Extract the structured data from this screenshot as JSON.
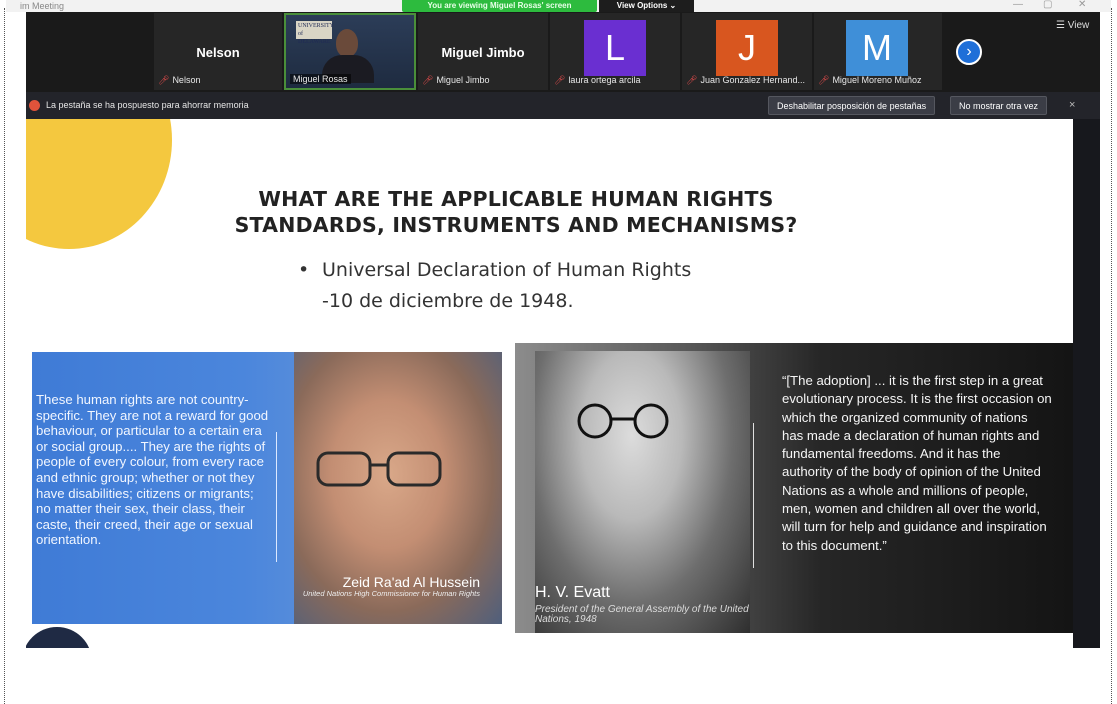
{
  "window": {
    "title": "im Meeting",
    "banner": "You are viewing Miguel Rosas' screen",
    "view_options": "View Options ⌄",
    "controls": [
      "—",
      "▢",
      "✕"
    ]
  },
  "participants": [
    {
      "display": "Nelson",
      "caption": "Nelson",
      "muted": true
    },
    {
      "display": "",
      "caption": "Miguel Rosas",
      "muted": false,
      "video": true
    },
    {
      "display": "Miguel Jimbo",
      "caption": "Miguel Jimbo",
      "muted": true
    },
    {
      "display": "L",
      "caption": "laura ortega arcila",
      "muted": true,
      "color": "#6a2fd1"
    },
    {
      "display": "J",
      "caption": "Juan Gonzalez Hernand...",
      "muted": true,
      "color": "#d8561f"
    },
    {
      "display": "M",
      "caption": "Miguel Moreno Muñoz",
      "muted": true,
      "color": "#3f8fd8"
    }
  ],
  "strip": {
    "next_icon": "›",
    "view_label": "☰ View",
    "logo_text": "UNIVERSITY of DELAWARE"
  },
  "notice": {
    "text": "La pestaña se ha pospuesto para ahorrar memoria",
    "disable_button": "Deshabilitar posposición de pestañas",
    "dismiss_button": "No mostrar otra vez",
    "close": "×"
  },
  "slide": {
    "title_line1": "WHAT ARE THE APPLICABLE HUMAN RIGHTS",
    "title_line2": "STANDARDS, INSTRUMENTS AND MECHANISMS?",
    "bullet_line1": "Universal Declaration of Human Rights",
    "bullet_line2": "-10 de diciembre de 1948.",
    "bullet_marker": "•",
    "left_card": {
      "quote": "These human rights are not country-specific. They are not a reward for good behaviour, or particular to a certain era or social group.... They are the rights of people of every colour, from every race and ethnic group; whether or not they have disabilities; citizens or migrants; no matter their sex, their class, their caste, their creed, their age or sexual orientation.",
      "person": "Zeid Ra'ad Al Hussein",
      "role": "United Nations High Commissioner for Human Rights"
    },
    "right_card": {
      "quote": "“[The adoption] ... it is the first step in a great evolutionary process. It is the first occasion on which the organized community of nations has made a declaration of human rights and fundamental freedoms. And it has the authority of the body of opinion of the United Nations as a whole and millions of people, men, women and children all over the world, will turn for help and guidance and inspiration to this document.”",
      "person": "H. V. Evatt",
      "role": "President of the General Assembly of the United Nations, 1948"
    }
  }
}
